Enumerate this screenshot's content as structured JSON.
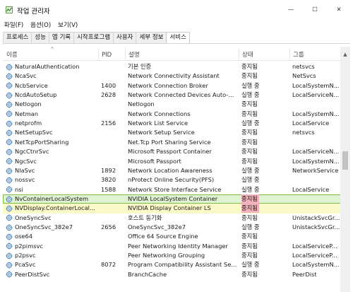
{
  "window": {
    "title": "작업 관리자",
    "minimize_glyph": "—",
    "maximize_glyph": "☐",
    "close_glyph": "✕"
  },
  "menu": [
    "파일(F)",
    "옵션(O)",
    "보기(V)"
  ],
  "tabs": [
    {
      "label": "프로세스",
      "active": false
    },
    {
      "label": "성능",
      "active": false
    },
    {
      "label": "앱 기록",
      "active": false
    },
    {
      "label": "시작프로그램",
      "active": false
    },
    {
      "label": "사용자",
      "active": false
    },
    {
      "label": "세부 정보",
      "active": false
    },
    {
      "label": "서비스",
      "active": true
    }
  ],
  "columns": {
    "name": "이름",
    "pid": "PID",
    "description": "설명",
    "status": "상태",
    "group": "그룹",
    "sort_arrow": "^"
  },
  "colors": {
    "highlight_green": "#dff2d2",
    "highlight_yellow": "#fafac8",
    "status_red": "#f2b3bc",
    "icon": "gear-icon"
  },
  "rows": [
    {
      "name": "NaturalAuthentication",
      "pid": "",
      "description": "기본 인증",
      "status": "중지됨",
      "group": "netsvcs"
    },
    {
      "name": "NcaSvc",
      "pid": "",
      "description": "Network Connectivity Assistant",
      "status": "중지됨",
      "group": "NetSvcs"
    },
    {
      "name": "NcbService",
      "pid": "1400",
      "description": "Network Connection Broker",
      "status": "실행 중",
      "group": "LocalSystemN..."
    },
    {
      "name": "NcdAutoSetup",
      "pid": "2628",
      "description": "Network Connected Devices Auto-...",
      "status": "실행 중",
      "group": "LocalServiceN..."
    },
    {
      "name": "Netlogon",
      "pid": "",
      "description": "Netlogon",
      "status": "중지됨",
      "group": ""
    },
    {
      "name": "Netman",
      "pid": "",
      "description": "Network Connections",
      "status": "중지됨",
      "group": "LocalSystemN..."
    },
    {
      "name": "netprofm",
      "pid": "2156",
      "description": "Network List Service",
      "status": "실행 중",
      "group": "LocalService"
    },
    {
      "name": "NetSetupSvc",
      "pid": "",
      "description": "Network Setup Service",
      "status": "중지됨",
      "group": "netsvcs"
    },
    {
      "name": "NetTcpPortSharing",
      "pid": "",
      "description": "Net.Tcp Port Sharing Service",
      "status": "중지됨",
      "group": ""
    },
    {
      "name": "NgcCtnrSvc",
      "pid": "",
      "description": "Microsoft Passport Container",
      "status": "중지됨",
      "group": "LocalServiceN..."
    },
    {
      "name": "NgcSvc",
      "pid": "",
      "description": "Microsoft Passport",
      "status": "중지됨",
      "group": "LocalSystemN..."
    },
    {
      "name": "NlaSvc",
      "pid": "1892",
      "description": "Network Location Awareness",
      "status": "실행 중",
      "group": "NetworkService"
    },
    {
      "name": "nossvc",
      "pid": "3820",
      "description": "nProtect Online Security(PFS)",
      "status": "실행 중",
      "group": ""
    },
    {
      "name": "nsi",
      "pid": "1588",
      "description": "Network Store Interface Service",
      "status": "실행 중",
      "group": "LocalService"
    },
    {
      "name": "NvContainerLocalSystem",
      "pid": "",
      "description": "NVIDIA LocalSystem Container",
      "status": "중지됨",
      "group": "",
      "highlight": "green"
    },
    {
      "name": "NVDisplay.ContainerLocal...",
      "pid": "",
      "description": "NVIDIA Display Container LS",
      "status": "중지됨",
      "group": "",
      "highlight": "yellow"
    },
    {
      "name": "OneSyncSvc",
      "pid": "",
      "description": "호스트 동기화",
      "status": "중지됨",
      "group": "UnistackSvcGr..."
    },
    {
      "name": "OneSyncSvc_382e7",
      "pid": "2656",
      "description": "OneSyncSvc_382e7",
      "status": "실행 중",
      "group": "UnistackSvcGr..."
    },
    {
      "name": "ose64",
      "pid": "",
      "description": "Office 64 Source Engine",
      "status": "중지됨",
      "group": ""
    },
    {
      "name": "p2pimsvc",
      "pid": "",
      "description": "Peer Networking Identity Manager",
      "status": "중지됨",
      "group": "LocalServiceP..."
    },
    {
      "name": "p2psvc",
      "pid": "",
      "description": "Peer Networking Grouping",
      "status": "중지됨",
      "group": "LocalServiceP..."
    },
    {
      "name": "PcaSvc",
      "pid": "8072",
      "description": "Program Compatibility Assistant Se...",
      "status": "실행 중",
      "group": "LocalSystemN..."
    },
    {
      "name": "PeerDistSvc",
      "pid": "",
      "description": "BranchCache",
      "status": "중지됨",
      "group": "PeerDist"
    }
  ]
}
